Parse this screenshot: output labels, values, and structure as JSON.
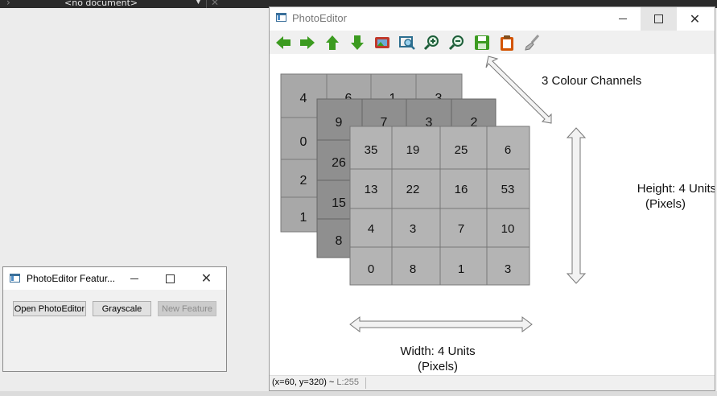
{
  "ide": {
    "document_label": "<no document>"
  },
  "main_window": {
    "title": "PhotoEditor",
    "toolbar": [
      {
        "name": "back-arrow-icon",
        "color": "#3c9b20"
      },
      {
        "name": "forward-arrow-icon",
        "color": "#3c9b20"
      },
      {
        "name": "up-arrow-icon",
        "color": "#3c9b20"
      },
      {
        "name": "down-arrow-icon",
        "color": "#3c9b20"
      },
      {
        "name": "image-icon",
        "color": "#c0392b"
      },
      {
        "name": "zoom-fit-icon",
        "color": "#2c6e8f"
      },
      {
        "name": "zoom-in-icon",
        "color": "#1e7a3c"
      },
      {
        "name": "zoom-out-icon",
        "color": "#1e7a3c"
      },
      {
        "name": "save-icon",
        "color": "#3c9b20"
      },
      {
        "name": "clipboard-icon",
        "color": "#c0392b"
      },
      {
        "name": "brush-icon",
        "color": "#8a8a8a"
      }
    ],
    "diagram": {
      "back_grid": [
        "4",
        "6",
        "1",
        "3",
        "0",
        "",
        "",
        "",
        "2",
        "",
        "",
        "",
        "1",
        "",
        "",
        ""
      ],
      "mid_grid": [
        "9",
        "7",
        "3",
        "2",
        "26",
        "",
        "",
        "",
        "15",
        "",
        "",
        "",
        "8",
        "",
        "",
        ""
      ],
      "front_grid": [
        "35",
        "19",
        "25",
        "6",
        "13",
        "22",
        "16",
        "53",
        "4",
        "3",
        "7",
        "10",
        "0",
        "8",
        "1",
        "3"
      ],
      "channels_label": "3 Colour Channels",
      "height_label_1": "Height: 4 Units",
      "height_label_2": "(Pixels)",
      "width_label_1": "Width: 4 Units",
      "width_label_2": "(Pixels)"
    },
    "status": {
      "coords": "(x=60, y=320) ~ ",
      "level": "L:255"
    }
  },
  "feature_window": {
    "title": "PhotoEditor Featur...",
    "buttons": {
      "open": "Open PhotoEditor",
      "grayscale": "Grayscale",
      "new_feature": "New Feature"
    }
  }
}
